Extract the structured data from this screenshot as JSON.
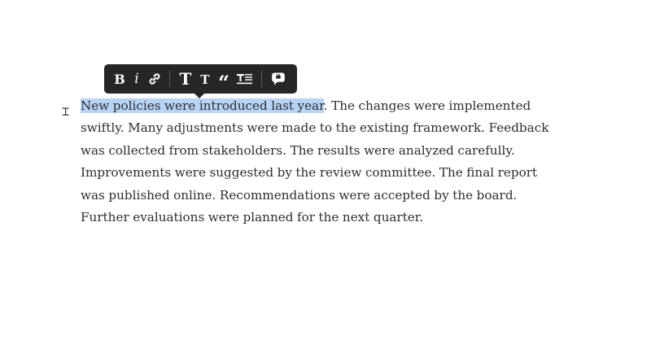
{
  "toolbar": {
    "bold": "B",
    "italic": "i",
    "heading_large": "T",
    "heading_small": "T",
    "quote": "“"
  },
  "icons": {
    "bold": "bold-icon",
    "italic": "italic-icon",
    "link": "link-icon",
    "heading_large": "heading-large-icon",
    "heading_small": "heading-small-icon",
    "quote": "quote-icon",
    "abstract": "abstract-icon",
    "comment": "comment-icon",
    "cursor": "text-cursor-icon"
  },
  "editor": {
    "selected_text": "New policies were introduced last year",
    "rest_lines": [
      ". The changes were implemented",
      "swiftly. Many adjustments were made to the existing framework. Feedback",
      "was collected from stakeholders. The results were analyzed carefully.",
      "Improvements were suggested by the review committee. The final report",
      "was published online. Recommendations were accepted by the board.",
      "Further evaluations were planned for the next quarter."
    ]
  },
  "colors": {
    "toolbar_bg": "#262626",
    "selection": "#b8d4f5",
    "text": "#2d2d2d"
  }
}
